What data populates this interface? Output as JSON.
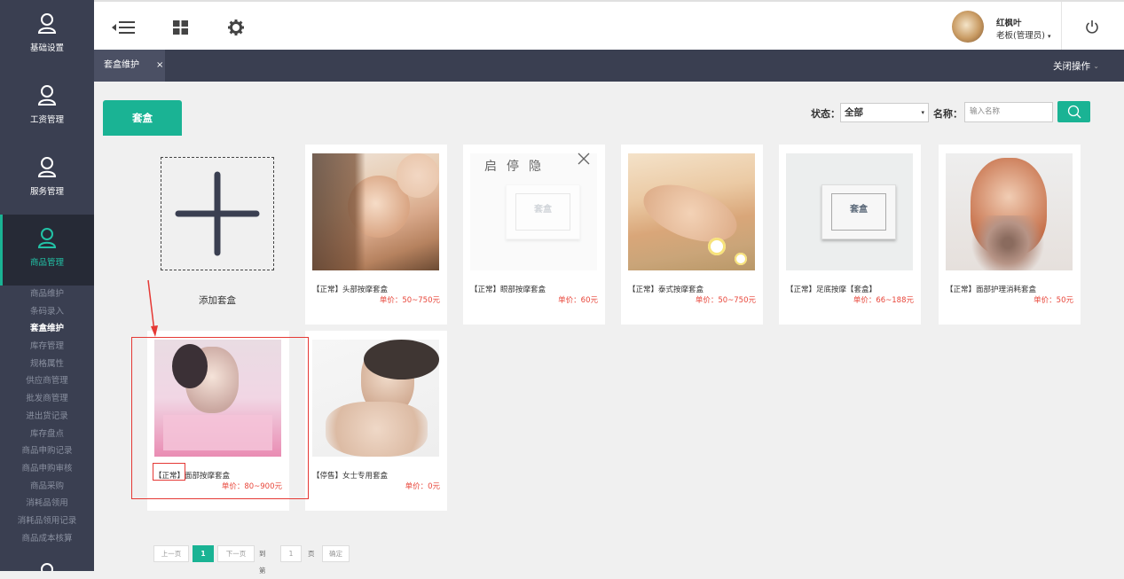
{
  "sidebar": {
    "items": [
      {
        "label": "基础设置",
        "icon": "person-icon"
      },
      {
        "label": "工资管理",
        "icon": "person-icon"
      },
      {
        "label": "服务管理",
        "icon": "person-icon"
      },
      {
        "label": "商品管理",
        "icon": "person-icon",
        "active": true
      }
    ],
    "submenu": [
      "商品维护",
      "条码录入",
      "套盒维护",
      "库存管理",
      "规格属性",
      "供应商管理",
      "批发商管理",
      "进出货记录",
      "库存盘点",
      "商品申购记录",
      "商品申购审核",
      "商品采购",
      "消耗品领用",
      "消耗品领用记录",
      "商品成本核算"
    ],
    "active_submenu": "套盒维护"
  },
  "topbar": {
    "icons": [
      "collapse-menu-icon",
      "grid-icon",
      "gear-icon"
    ],
    "user_name": "红枫叶",
    "user_role": "老板(管理员)",
    "power_icon": "power-icon"
  },
  "tabs": {
    "active_label": "套盒维护",
    "close_symbol": "×",
    "close_ops": "关闭操作",
    "close_ops_caret": "⌄"
  },
  "panel": {
    "tab_label": "套盒",
    "status_label": "状态：",
    "status_value": "全部",
    "status_caret": "▾",
    "name_label": "名称：",
    "name_placeholder": "输入名称"
  },
  "add_card": {
    "label": "添加套盒"
  },
  "cards": [
    {
      "title": "【正常】头部按摩套盒",
      "price": "单价：50~750元",
      "image": "head-massage-photo"
    },
    {
      "title": "【正常】眼部按摩套盒",
      "price": "单价：60元",
      "image": "package-box",
      "box_label": "套盒",
      "hover_actions": "启停隐"
    },
    {
      "title": "【正常】泰式按摩套盒",
      "price": "单价：50~750元",
      "image": "spa-massage-photo"
    },
    {
      "title": "【正常】足底按摩【套盒】",
      "price": "单价：66~188元",
      "image": "package-box",
      "box_label": "套盒"
    },
    {
      "title": "【正常】面部护理消耗套盒",
      "price": "单价：50元",
      "image": "flower-portrait-photo"
    },
    {
      "title": "【正常】面部按摩套盒",
      "price": "单价：80~900元",
      "image": "cosmetic-poster-photo",
      "title_prefix": "【正常】",
      "title_rest": "面部按摩套盒"
    },
    {
      "title": "【停售】女士专用套盒",
      "price": "单价：0元",
      "image": "woman-portrait-photo"
    }
  ],
  "pager": {
    "prev": "上一页",
    "current": "1",
    "next": "下一页",
    "goto": "到第",
    "page_input": "1",
    "page_unit": "页",
    "confirm": "确定"
  },
  "colors": {
    "accent": "#1ab394",
    "sidebar_bg": "#3a3f51",
    "price_red": "#e8463a",
    "annotation_red": "#e53935"
  }
}
